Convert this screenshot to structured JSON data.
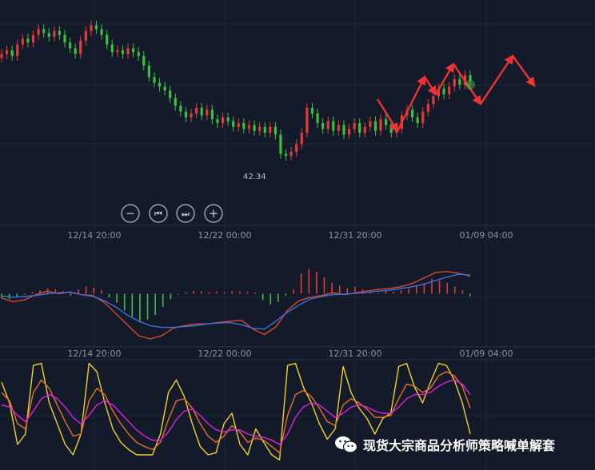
{
  "chart_data": [
    {
      "type": "candlestick",
      "x_ticks": [
        "12/14 20:00",
        "12/22 00:00",
        "12/31 20:00",
        "01/09 04:00"
      ],
      "annotations": {
        "low_label": "42.34"
      },
      "colors": {
        "up": "#e23b3b",
        "down": "#3fbf3f",
        "arrow": "#ee3333"
      },
      "price_ylim": [
        40,
        50
      ],
      "candles_close": [
        47.6,
        47.8,
        47.5,
        48.1,
        48.4,
        48.2,
        48.6,
        48.9,
        48.7,
        48.5,
        48.8,
        48.6,
        48.2,
        47.9,
        47.6,
        48.3,
        48.8,
        49.1,
        48.9,
        48.6,
        48.1,
        47.7,
        47.8,
        47.6,
        47.9,
        47.7,
        47.5,
        47.0,
        46.4,
        46.1,
        45.9,
        45.7,
        45.3,
        44.9,
        44.6,
        44.3,
        44.5,
        44.8,
        44.4,
        44.7,
        44.2,
        44.0,
        44.3,
        44.1,
        43.8,
        44.0,
        43.7,
        43.9,
        43.6,
        43.8,
        43.5,
        43.8,
        43.4,
        42.4,
        42.3,
        42.5,
        42.9,
        43.5,
        44.8,
        44.5,
        44.0,
        43.7,
        44.1,
        43.6,
        43.9,
        43.4,
        43.7,
        44.0,
        43.5,
        43.8,
        44.1,
        43.6,
        44.2,
        43.9,
        43.5,
        43.7,
        44.4,
        44.7,
        44.3,
        44.0,
        44.6,
        45.0,
        45.4,
        45.8,
        45.5,
        45.9,
        46.3,
        46.0,
        46.5,
        46.2
      ]
    },
    {
      "type": "bar+line",
      "x_ticks": [
        "12/14 20:00",
        "12/22 00:00",
        "12/31 20:00",
        "01/09 04:00"
      ],
      "ylim": [
        -1.2,
        1.0
      ],
      "histogram": [
        -0.1,
        -0.12,
        -0.08,
        -0.02,
        0.04,
        0.08,
        0.12,
        0.1,
        0.06,
        -0.04,
        0.1,
        0.16,
        0.14,
        0.08,
        -0.08,
        -0.2,
        -0.38,
        -0.52,
        -0.65,
        -0.58,
        -0.48,
        -0.3,
        -0.12,
        -0.02,
        0.04,
        0.06,
        0.05,
        0.04,
        0.05,
        0.04,
        0.06,
        0.05,
        0.04,
        0.03,
        -0.14,
        -0.24,
        -0.18,
        -0.04,
        0.1,
        0.46,
        0.56,
        0.5,
        0.38,
        0.24,
        0.18,
        0.12,
        0.16,
        0.1,
        0.04,
        0.02,
        0.06,
        0.04,
        0.08,
        0.12,
        0.18,
        0.24,
        0.34,
        0.3,
        0.24,
        0.16,
        0.08,
        -0.06
      ],
      "dif": [
        -0.1,
        -0.18,
        -0.14,
        -0.02,
        0.06,
        0.0,
        0.04,
        -0.02,
        -0.04,
        -0.2,
        -0.45,
        -0.7,
        -0.95,
        -1.02,
        -0.95,
        -0.78,
        -0.72,
        -0.68,
        -0.68,
        -0.65,
        -0.62,
        -0.6,
        -0.8,
        -0.92,
        -0.75,
        -0.38,
        -0.16,
        -0.08,
        -0.04,
        0.02,
        -0.02,
        0.02,
        0.06,
        0.1,
        0.12,
        0.16,
        0.24,
        0.36,
        0.48,
        0.5,
        0.46,
        0.4
      ],
      "dea": [
        -0.05,
        -0.08,
        -0.06,
        -0.04,
        0.0,
        0.02,
        0.03,
        -0.02,
        -0.06,
        -0.16,
        -0.3,
        -0.48,
        -0.62,
        -0.72,
        -0.76,
        -0.76,
        -0.74,
        -0.72,
        -0.68,
        -0.66,
        -0.65,
        -0.7,
        -0.78,
        -0.8,
        -0.62,
        -0.42,
        -0.26,
        -0.12,
        -0.06,
        -0.02,
        -0.01,
        0.01,
        0.03,
        0.06,
        0.08,
        0.12,
        0.16,
        0.22,
        0.3,
        0.38,
        0.44,
        0.42
      ],
      "colors": {
        "pos": "#e23b3b",
        "neg": "#3fbf3f",
        "dif": "#d9482f",
        "dea": "#3f6fe0"
      }
    },
    {
      "type": "line",
      "x_ticks": [
        "12/14 20:00",
        "12/22 00:00",
        "12/31 20:00",
        "01/09 04:00"
      ],
      "ylim": [
        0,
        100
      ],
      "series": [
        {
          "color": "#f2d12e",
          "values": [
            80,
            60,
            20,
            30,
            96,
            98,
            60,
            40,
            20,
            10,
            30,
            98,
            90,
            60,
            35,
            22,
            15,
            10,
            10,
            10,
            30,
            70,
            82,
            66,
            40,
            18,
            10,
            12,
            40,
            50,
            20,
            10,
            35,
            22,
            10,
            5,
            96,
            98,
            75,
            60,
            40,
            25,
            35,
            95,
            70,
            55,
            45,
            30,
            45,
            50,
            95,
            98,
            75,
            60,
            80,
            98,
            96,
            82,
            60,
            30
          ]
        },
        {
          "color": "#e5722a",
          "values": [
            70,
            62,
            40,
            35,
            70,
            82,
            74,
            58,
            42,
            28,
            30,
            62,
            74,
            68,
            52,
            40,
            30,
            22,
            18,
            15,
            22,
            44,
            62,
            64,
            55,
            40,
            28,
            22,
            28,
            38,
            32,
            22,
            26,
            24,
            18,
            12,
            48,
            68,
            72,
            66,
            55,
            42,
            38,
            58,
            64,
            60,
            54,
            46,
            46,
            48,
            64,
            78,
            76,
            70,
            74,
            86,
            90,
            86,
            76,
            55
          ]
        },
        {
          "color": "#dd22dd",
          "values": [
            58,
            56,
            48,
            42,
            52,
            64,
            68,
            64,
            56,
            46,
            40,
            48,
            58,
            62,
            58,
            50,
            42,
            34,
            28,
            24,
            24,
            32,
            44,
            52,
            54,
            48,
            40,
            34,
            32,
            34,
            34,
            30,
            28,
            27,
            24,
            20,
            30,
            46,
            56,
            60,
            58,
            52,
            46,
            50,
            56,
            58,
            56,
            52,
            50,
            50,
            56,
            64,
            68,
            68,
            70,
            76,
            80,
            82,
            78,
            68
          ]
        }
      ]
    }
  ],
  "controls": {
    "zoom_out": "−",
    "prev": "⏮",
    "next": "⏭",
    "zoom_in": "+"
  },
  "watermark": {
    "text": "现货大宗商品分析师策略喊单解套"
  }
}
